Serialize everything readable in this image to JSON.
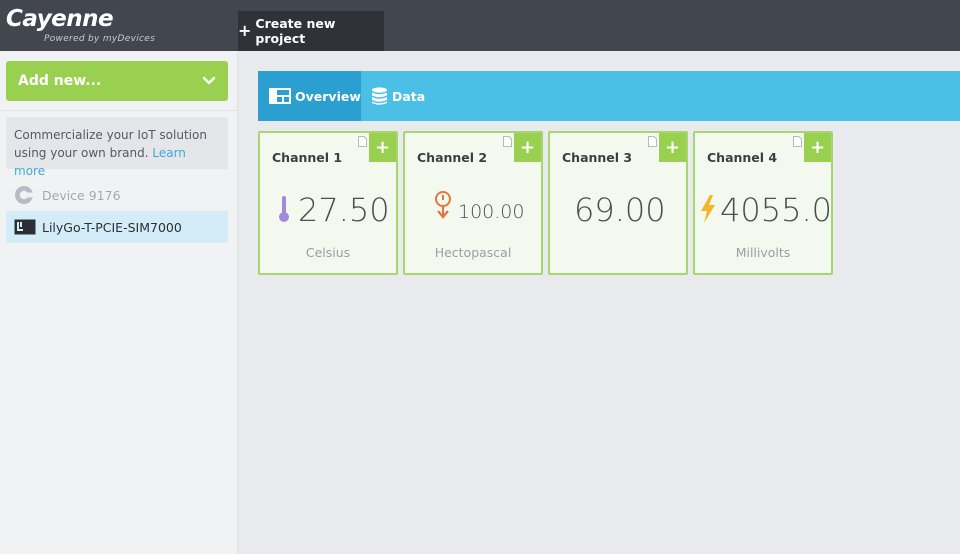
{
  "header": {
    "logo": "Cayenne",
    "logo_tagline": "Powered by myDevices",
    "create_project_label": "Create new project"
  },
  "sidebar": {
    "add_new_label": "Add new...",
    "promo_text": "Commercialize your IoT solution using your own brand.",
    "promo_link": "Learn more",
    "device_group": "Device 9176",
    "device_item": "LilyGo-T-PCIE-SIM7000"
  },
  "tabs": [
    {
      "label": "Overview",
      "icon": "dashboard-icon",
      "active": true
    },
    {
      "label": "Data",
      "icon": "database-icon",
      "active": false
    }
  ],
  "widgets": [
    {
      "title": "Channel 1",
      "value": "27.50",
      "unit": "Celsius",
      "icon": "thermometer-icon"
    },
    {
      "title": "Channel 2",
      "value": "100.00",
      "unit": "Hectopascal",
      "icon": "pressure-icon"
    },
    {
      "title": "Channel 3",
      "value": "69.00",
      "unit": "",
      "icon": ""
    },
    {
      "title": "Channel 4",
      "value": "4055.00",
      "unit": "Millivolts",
      "icon": "lightning-icon"
    }
  ],
  "colors": {
    "accent_green": "#9ad04f",
    "tab_blue": "#4bbfe6",
    "tab_active": "#2a9fd0",
    "topbar": "#42474f"
  }
}
